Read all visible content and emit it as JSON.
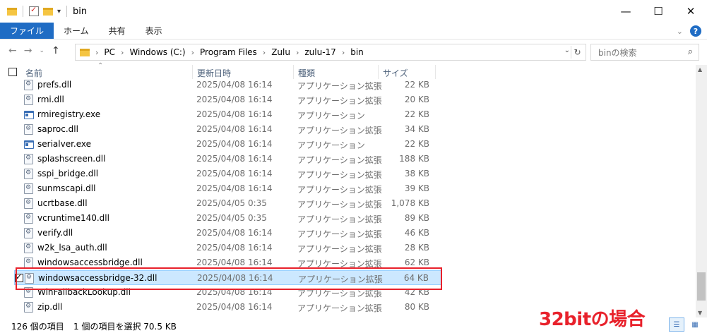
{
  "window": {
    "title": "bin",
    "minimize": "—",
    "maximize": "☐",
    "close": "✕"
  },
  "ribbon": {
    "tabs": [
      "ファイル",
      "ホーム",
      "共有",
      "表示"
    ]
  },
  "address": {
    "crumbs": [
      "PC",
      "Windows (C:)",
      "Program Files",
      "Zulu",
      "zulu-17",
      "bin"
    ],
    "search_placeholder": "binの検索"
  },
  "columns": {
    "name": "名前",
    "date": "更新日時",
    "type": "種類",
    "size": "サイズ"
  },
  "files": [
    {
      "name": "prefs.dll",
      "date": "2025/04/08 16:14",
      "type": "アプリケーション拡張",
      "size": "22 KB",
      "icon": "dll-file-icon"
    },
    {
      "name": "rmi.dll",
      "date": "2025/04/08 16:14",
      "type": "アプリケーション拡張",
      "size": "20 KB",
      "icon": "dll-file-icon"
    },
    {
      "name": "rmiregistry.exe",
      "date": "2025/04/08 16:14",
      "type": "アプリケーション",
      "size": "22 KB",
      "icon": "exe-file-icon"
    },
    {
      "name": "saproc.dll",
      "date": "2025/04/08 16:14",
      "type": "アプリケーション拡張",
      "size": "34 KB",
      "icon": "dll-file-icon"
    },
    {
      "name": "serialver.exe",
      "date": "2025/04/08 16:14",
      "type": "アプリケーション",
      "size": "22 KB",
      "icon": "exe-file-icon"
    },
    {
      "name": "splashscreen.dll",
      "date": "2025/04/08 16:14",
      "type": "アプリケーション拡張",
      "size": "188 KB",
      "icon": "dll-file-icon"
    },
    {
      "name": "sspi_bridge.dll",
      "date": "2025/04/08 16:14",
      "type": "アプリケーション拡張",
      "size": "38 KB",
      "icon": "dll-file-icon"
    },
    {
      "name": "sunmscapi.dll",
      "date": "2025/04/08 16:14",
      "type": "アプリケーション拡張",
      "size": "39 KB",
      "icon": "dll-file-icon"
    },
    {
      "name": "ucrtbase.dll",
      "date": "2025/04/05 0:35",
      "type": "アプリケーション拡張",
      "size": "1,078 KB",
      "icon": "dll-file-icon"
    },
    {
      "name": "vcruntime140.dll",
      "date": "2025/04/05 0:35",
      "type": "アプリケーション拡張",
      "size": "89 KB",
      "icon": "dll-file-icon"
    },
    {
      "name": "verify.dll",
      "date": "2025/04/08 16:14",
      "type": "アプリケーション拡張",
      "size": "46 KB",
      "icon": "dll-file-icon"
    },
    {
      "name": "w2k_lsa_auth.dll",
      "date": "2025/04/08 16:14",
      "type": "アプリケーション拡張",
      "size": "28 KB",
      "icon": "dll-file-icon"
    },
    {
      "name": "windowsaccessbridge.dll",
      "date": "2025/04/08 16:14",
      "type": "アプリケーション拡張",
      "size": "62 KB",
      "icon": "dll-file-icon"
    },
    {
      "name": "windowsaccessbridge-32.dll",
      "date": "2025/04/08 16:14",
      "type": "アプリケーション拡張",
      "size": "64 KB",
      "icon": "dll-file-icon",
      "selected": true
    },
    {
      "name": "WinFallbackLookup.dll",
      "date": "2025/04/08 16:14",
      "type": "アプリケーション拡張",
      "size": "42 KB",
      "icon": "dll-file-icon"
    },
    {
      "name": "zip.dll",
      "date": "2025/04/08 16:14",
      "type": "アプリケーション拡張",
      "size": "80 KB",
      "icon": "dll-file-icon"
    }
  ],
  "status": {
    "count": "126 個の項目",
    "selection": "1 個の項目を選択  70.5 KB"
  },
  "annotation": {
    "text": "32bitの場合",
    "color": "#e8212b"
  },
  "colors": {
    "accent": "#1f6cc4",
    "selection_bg": "#cce8ff",
    "highlight": "#e8212b"
  }
}
